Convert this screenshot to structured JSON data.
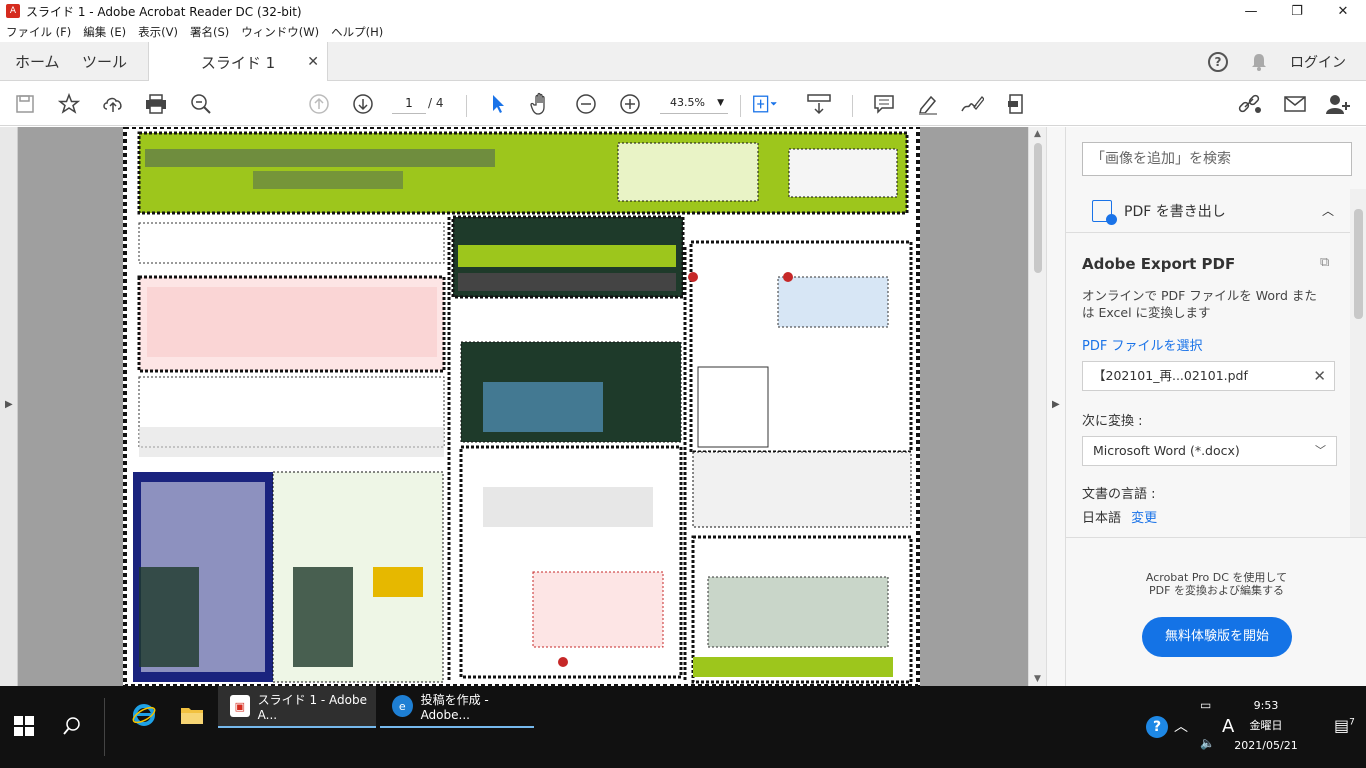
{
  "window": {
    "title": "スライド 1 - Adobe Acrobat Reader DC (32-bit)",
    "controls": {
      "minimize": "—",
      "maximize": "❐",
      "close": "✕"
    }
  },
  "menubar": [
    "ファイル (F)",
    "編集 (E)",
    "表示(V)",
    "署名(S)",
    "ウィンドウ(W)",
    "ヘルプ(H)"
  ],
  "tabs": {
    "home": "ホーム",
    "tools": "ツール",
    "doc": "スライド 1",
    "doc_close": "✕",
    "login": "ログイン"
  },
  "toolbar": {
    "page_current": "1",
    "page_total": "/ 4",
    "zoom": "43.5%"
  },
  "right_panel": {
    "search_placeholder": "「画像を追加」を検索",
    "export_header": "PDF を書き出し",
    "export_title": "Adobe Export PDF",
    "export_desc": "オンラインで PDF ファイルを Word または Excel に変換します",
    "select_file_link": "PDF ファイルを選択",
    "selected_file": "【202101_再...02101.pdf",
    "convert_to_label": "次に変換 :",
    "convert_to_value": "Microsoft Word (*.docx)",
    "doc_lang_label": "文書の言語 :",
    "doc_lang_value": "日本語",
    "doc_lang_change": "変更",
    "promo_line1": "Acrobat Pro DC を使用して",
    "promo_line2": "PDF を変換および編集する",
    "trial_button": "無料体験版を開始"
  },
  "taskbar": {
    "tasks": [
      {
        "label": "スライド 1 - Adobe A...",
        "active": true
      },
      {
        "label": "投稿を作成 - Adobe...",
        "active": false
      }
    ],
    "time": "9:53",
    "weekday": "金曜日",
    "date": "2021/05/21",
    "ime": "A",
    "notification_count": "7"
  },
  "colors": {
    "accent": "#1473e6",
    "slide_green": "#9dc61c",
    "slide_navy": "#1a237e",
    "slide_dark_green": "#1e3a2a"
  }
}
